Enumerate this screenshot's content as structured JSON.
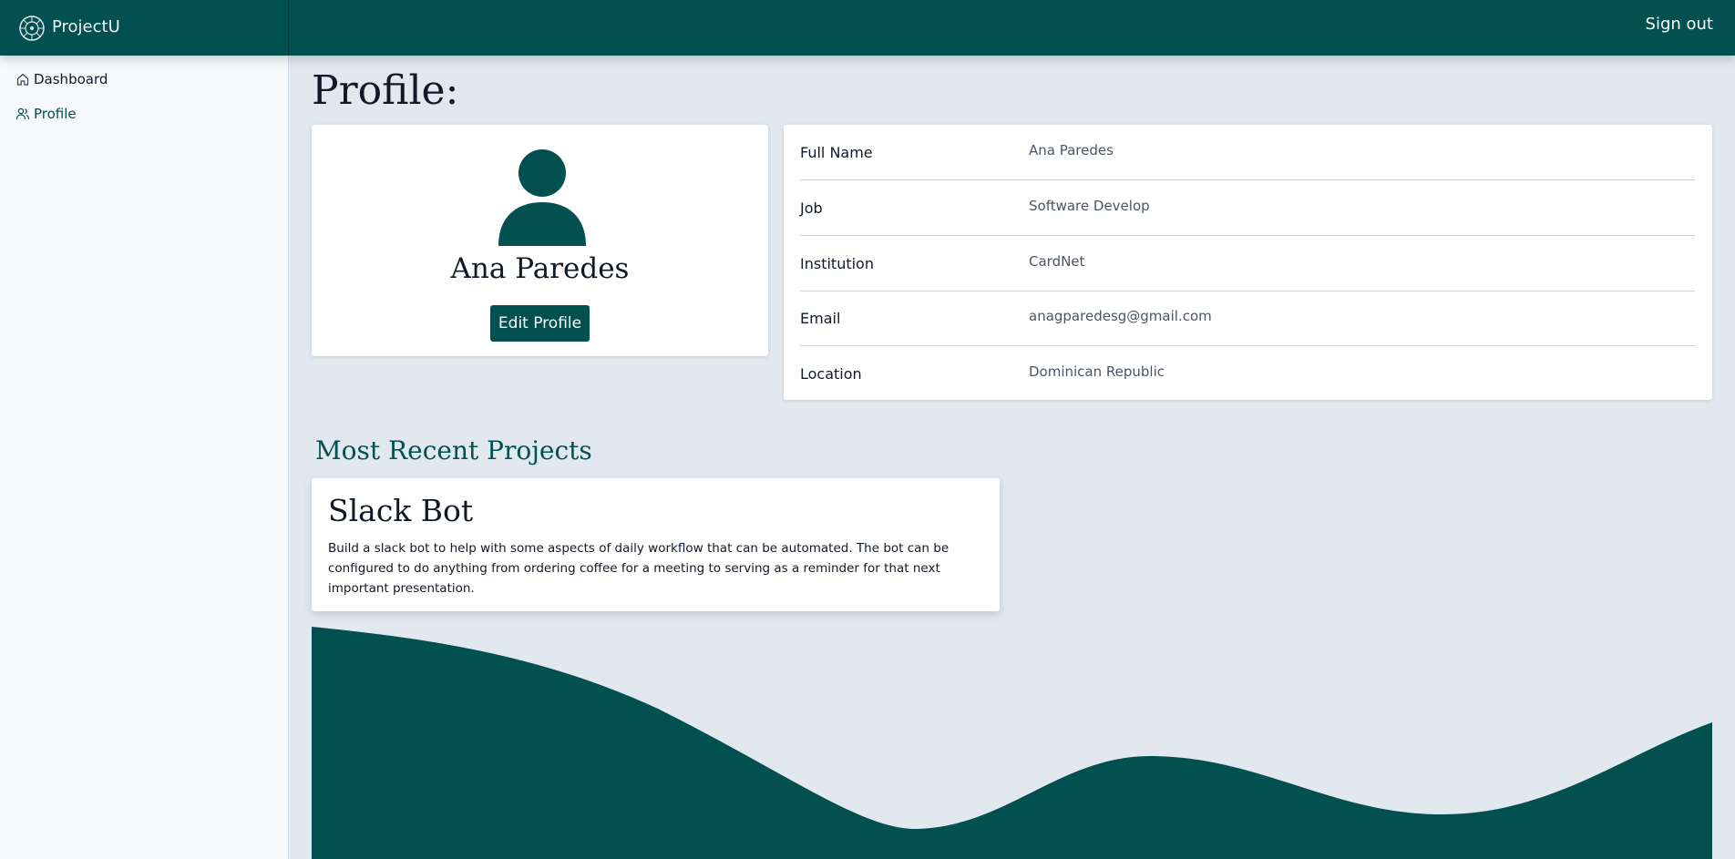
{
  "app": {
    "brand": "ProjectU",
    "signout_label": "Sign out"
  },
  "sidebar": {
    "items": [
      {
        "label": "Dashboard",
        "icon": "home-icon",
        "active": false
      },
      {
        "label": "Profile",
        "icon": "users-icon",
        "active": true
      }
    ]
  },
  "page": {
    "title": "Profile:"
  },
  "profile": {
    "name": "Ana Paredes",
    "edit_label": "Edit Profile"
  },
  "info": [
    {
      "label": "Full Name",
      "value": "Ana Paredes"
    },
    {
      "label": "Job",
      "value": "Software Develop"
    },
    {
      "label": "Institution",
      "value": "CardNet"
    },
    {
      "label": "Email",
      "value": "anagparedesg@gmail.com"
    },
    {
      "label": "Location",
      "value": "Dominican Republic"
    }
  ],
  "projects": {
    "heading": "Most Recent Projects",
    "items": [
      {
        "title": "Slack Bot",
        "description": "Build a slack bot to help with some aspects of daily workflow that can be automated. The bot can be configured to do anything from ordering coffee for a meeting to serving as a reminder for that next important presentation."
      }
    ]
  },
  "colors": {
    "primary": "#025050",
    "background": "#e2e8f0",
    "sidebar": "#f6f8fb"
  }
}
